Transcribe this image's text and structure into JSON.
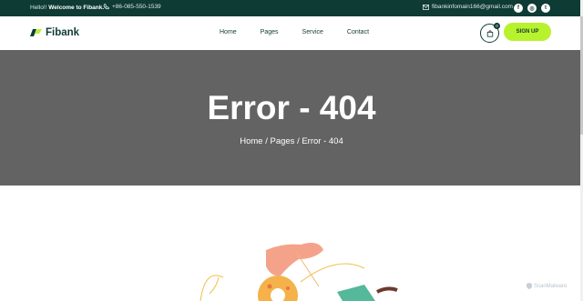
{
  "topbar": {
    "greeting_prefix": "Hello!!",
    "greeting_bold": "Welcome to Fibank.",
    "phone": "+86-085-550-1539",
    "email": "fibankinfomain166@gmail.com",
    "social": [
      {
        "icon": "facebook-icon",
        "glyph": "f"
      },
      {
        "icon": "instagram-icon",
        "glyph": "◎"
      },
      {
        "icon": "twitter-icon",
        "glyph": "t"
      }
    ]
  },
  "header": {
    "logo_text": "Fibank",
    "nav": [
      "Home",
      "Pages",
      "Service",
      "Contact"
    ],
    "cart_count": "0",
    "signup_label": "SIGN UP"
  },
  "banner": {
    "title": "Error - 404",
    "breadcrumb": "Home / Pages / Error - 404"
  },
  "watermark": "ScanMalware",
  "colors": {
    "topbar_bg": "#0e3b34",
    "accent": "#b8f22d",
    "banner_bg": "#636363"
  }
}
